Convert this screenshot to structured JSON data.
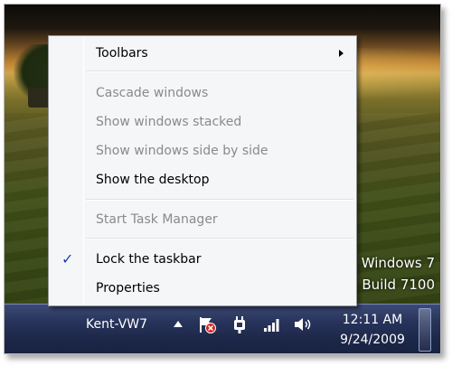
{
  "menu": {
    "items": [
      {
        "label": "Toolbars",
        "enabled": true,
        "submenu": true
      },
      {
        "label": "Cascade windows",
        "enabled": false
      },
      {
        "label": "Show windows stacked",
        "enabled": false
      },
      {
        "label": "Show windows side by side",
        "enabled": false
      },
      {
        "label": "Show the desktop",
        "enabled": true
      },
      {
        "label": "Start Task Manager",
        "enabled": false
      },
      {
        "label": "Lock the taskbar",
        "enabled": true,
        "checked": true
      },
      {
        "label": "Properties",
        "enabled": true
      }
    ]
  },
  "desktop": {
    "watermark_line1": "Windows 7",
    "watermark_line2": "Build 7100"
  },
  "taskbar": {
    "username": "Kent-VW7",
    "clock_time": "12:11 AM",
    "clock_date": "9/24/2009",
    "tray_icons": [
      "show-hidden-icons-arrow-icon",
      "action-center-flag-error-icon",
      "power-plug-icon",
      "network-signal-icon",
      "volume-speaker-icon"
    ]
  },
  "colors": {
    "taskbar_top": "#3c4a75",
    "taskbar_bottom": "#182140",
    "menu_background": "#f5f6f7",
    "check_color": "#1a3fbf",
    "disabled_text": "#8a8a8a"
  }
}
